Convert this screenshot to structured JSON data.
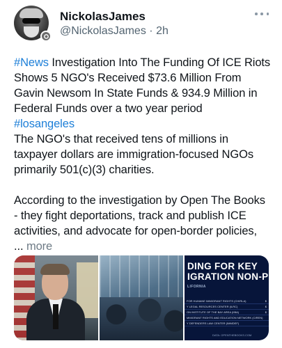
{
  "author": {
    "display_name": "NickolasJames",
    "handle": "@NickolasJames",
    "separator": "·",
    "time_ago": "2h",
    "avatar_icon": "profile-avatar",
    "badge_icon": "community-badge-icon"
  },
  "menu": {
    "icon": "more-options-icon"
  },
  "post": {
    "hashtag_news": "#News",
    "headline": " Investigation Into The Funding Of ICE Riots Shows 5 NGO's Received $73.6 Million From Gavin Newsom In State Funds & 934.9 Million in Federal Funds over a two year period",
    "hashtag_location": "#losangeles",
    "paragraph_1": "The NGO's that received tens of millions in taxpayer dollars are immigration-focused NGOs primarily 501(c)(3) charities.",
    "paragraph_2": "According to the investigation by Open The Books - they fight deportations, track and publish ICE activities, and advocate for open-border policies,",
    "ellipsis": "...",
    "more_label": "more"
  },
  "media": {
    "image_3_title_line1": "DING FOR KEY",
    "image_3_title_line2": "IGRATION NON-PROFITS",
    "image_3_subtitle": "LIFORNIA",
    "image_3_rows": [
      {
        "name": "FOR HUMANE IMMIGRANT RIGHTS (CHIRLA)",
        "value": "$"
      },
      {
        "name": "Y LEGAL RESOURCES CENTER (ILRC)",
        "value": "$"
      },
      {
        "name": "ON INSTITUTE OF THE BAY AREA (IIBA)",
        "value": "$"
      },
      {
        "name": "MMIGRANT RIGHTS AND EDUCATION NETWORK (CIREN)",
        "value": ""
      },
      {
        "name": "Y DEFENDERS LAW CENTER (IMMDEF)",
        "value": ""
      }
    ],
    "image_3_footer": "DATA: OPENTHEBOOKS.COM",
    "colors": {
      "image_3_bg": "#07153a",
      "hashtag": "#1d7fd8"
    }
  }
}
